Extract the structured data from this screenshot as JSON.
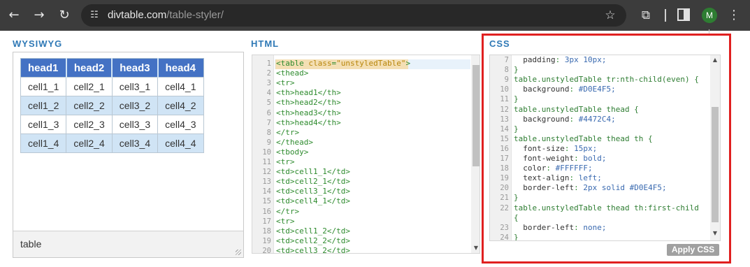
{
  "browser": {
    "url_host": "divtable.com",
    "url_path": "/table-styler/",
    "avatar_letter": "M"
  },
  "sections": {
    "wysiwyg_title": "WYSIWYG",
    "html_title": "HTML",
    "css_title": "CSS"
  },
  "preview_table": {
    "headers": [
      "head1",
      "head2",
      "head3",
      "head4"
    ],
    "rows": [
      [
        "cell1_1",
        "cell2_1",
        "cell3_1",
        "cell4_1"
      ],
      [
        "cell1_2",
        "cell2_2",
        "cell3_2",
        "cell4_2"
      ],
      [
        "cell1_3",
        "cell2_3",
        "cell3_3",
        "cell4_3"
      ],
      [
        "cell1_4",
        "cell2_4",
        "cell3_4",
        "cell4_4"
      ]
    ]
  },
  "wysiwyg_footer": "table",
  "html_editor": {
    "line_numbers": [
      "1",
      "2",
      "3",
      "4",
      "5",
      "6",
      "7",
      "8",
      "9",
      "10",
      "11",
      "12",
      "13",
      "14",
      "15",
      "16",
      "17",
      "18",
      "19",
      "20"
    ],
    "lines": [
      "<table class=\"unstyledTable\">",
      "<thead>",
      "<tr>",
      "<th>head1</th>",
      "<th>head2</th>",
      "<th>head3</th>",
      "<th>head4</th>",
      "</tr>",
      "</thead>",
      "<tbody>",
      "<tr>",
      "<td>cell1_1</td>",
      "<td>cell2_1</td>",
      "<td>cell3_1</td>",
      "<td>cell4_1</td>",
      "</tr>",
      "<tr>",
      "<td>cell1_2</td>",
      "<td>cell2_2</td>",
      "<td>cell3_2</td>"
    ]
  },
  "css_editor": {
    "line_numbers": [
      "7",
      "8",
      "9",
      "10",
      "11",
      "12",
      "13",
      "14",
      "15",
      "16",
      "17",
      "18",
      "19",
      "20",
      "21",
      "22",
      "",
      "23",
      "24"
    ],
    "lines": [
      "  padding: 3px 10px;",
      "}",
      "table.unstyledTable tr:nth-child(even) {",
      "  background: #D0E4F5;",
      "}",
      "table.unstyledTable thead {",
      "  background: #4472C4;",
      "}",
      "table.unstyledTable thead th {",
      "  font-size: 15px;",
      "  font-weight: bold;",
      "  color: #FFFFFF;",
      "  text-align: left;",
      "  border-left: 2px solid #D0E4F5;",
      "}",
      "table.unstyledTable thead th:first-child",
      "{",
      "  border-left: none;",
      "}"
    ]
  },
  "apply_button_label": "Apply CSS",
  "colors": {
    "header_bg": "#4472C4",
    "even_row_bg": "#D0E4F5",
    "section_title": "#2F79B6",
    "highlight_border": "#E02020"
  }
}
